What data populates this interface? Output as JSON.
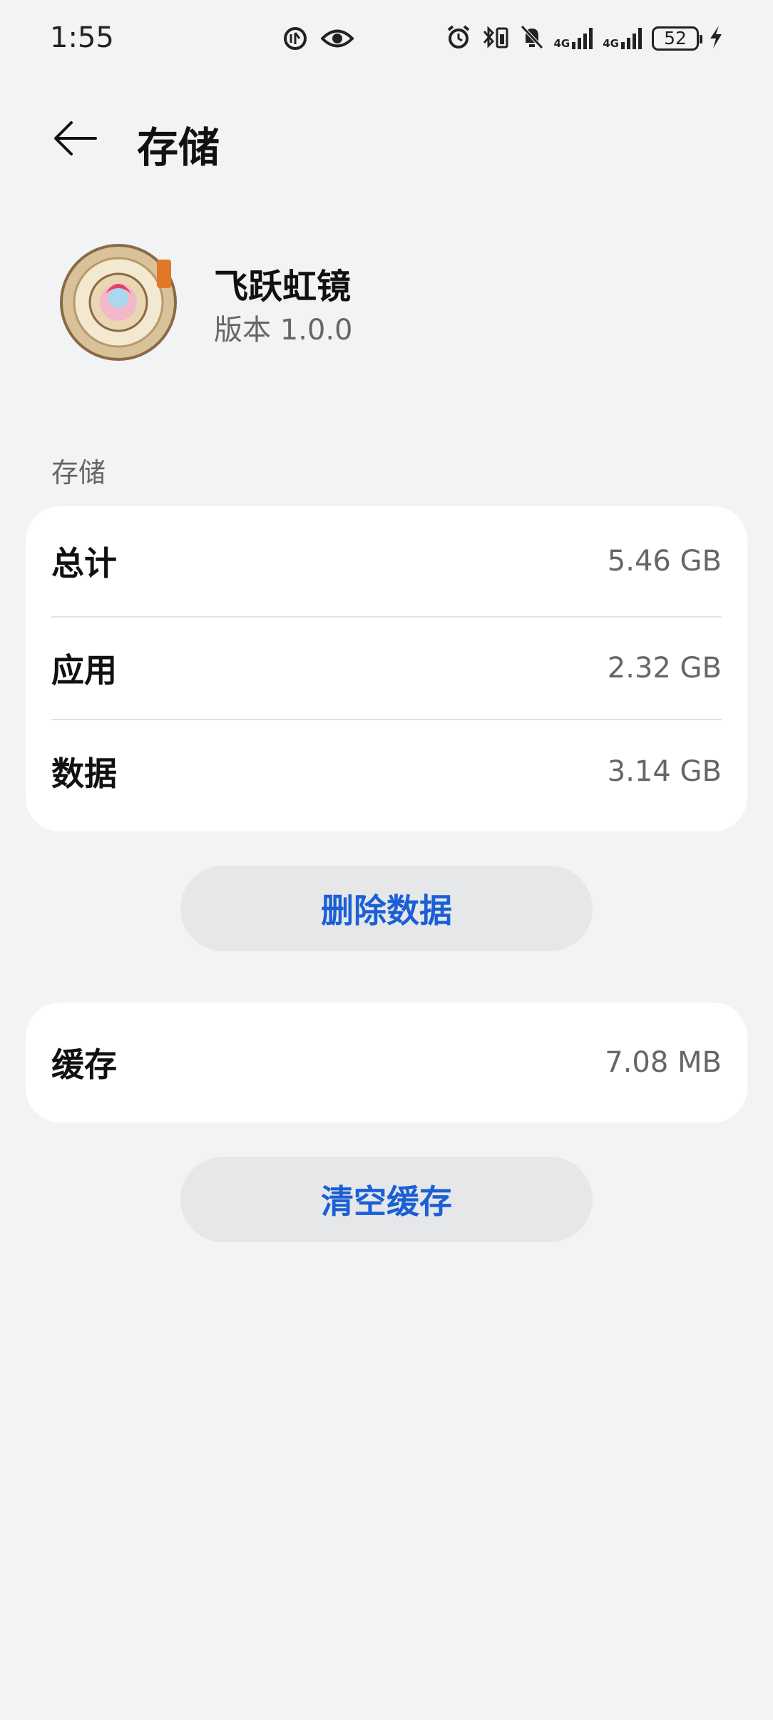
{
  "status_bar": {
    "time": "1:55",
    "battery_level": "52",
    "network_1": "4G",
    "network_2": "4G"
  },
  "header": {
    "title": "存储"
  },
  "app": {
    "name": "飞跃虹镜",
    "version": "版本 1.0.0"
  },
  "storage": {
    "section_label": "存储",
    "rows": [
      {
        "label": "总计",
        "value": "5.46 GB"
      },
      {
        "label": "应用",
        "value": "2.32 GB"
      },
      {
        "label": "数据",
        "value": "3.14 GB"
      }
    ],
    "delete_button": "删除数据"
  },
  "cache": {
    "label": "缓存",
    "value": "7.08 MB",
    "clear_button": "清空缓存"
  }
}
